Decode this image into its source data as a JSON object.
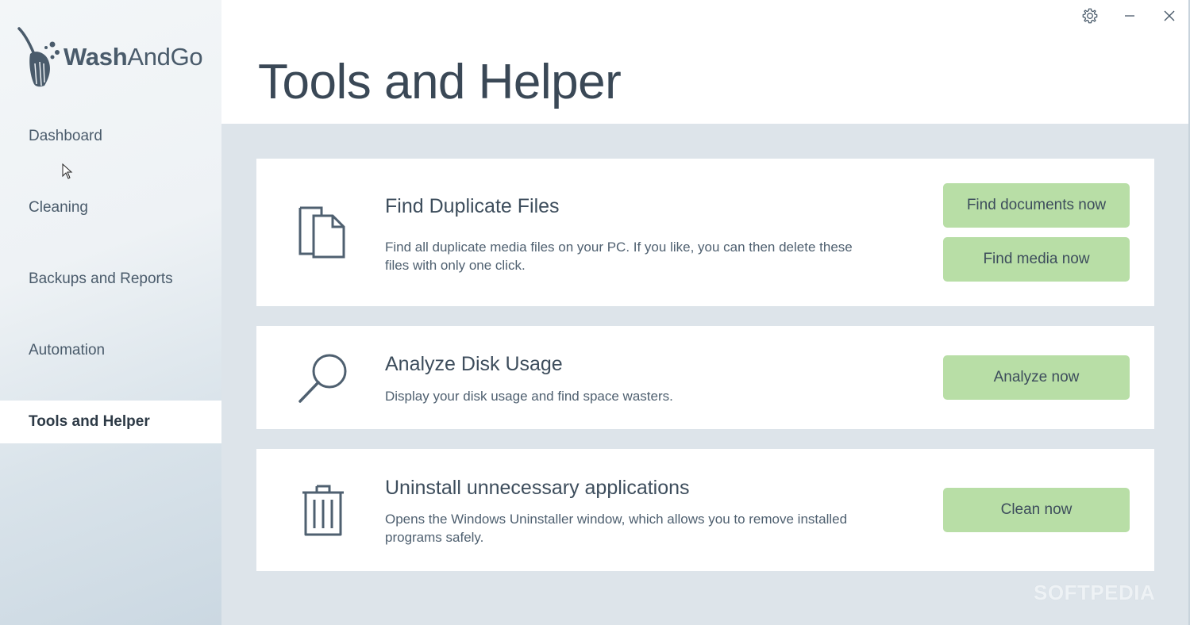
{
  "app": {
    "logo_text_bold": "Wash",
    "logo_text_light": "AndGo"
  },
  "sidebar": {
    "items": [
      {
        "label": "Dashboard",
        "active": false
      },
      {
        "label": "Cleaning",
        "active": false
      },
      {
        "label": "Backups and Reports",
        "active": false
      },
      {
        "label": "Automation",
        "active": false
      },
      {
        "label": "Tools and Helper",
        "active": true
      }
    ]
  },
  "window_controls": {
    "settings_icon": "gear-icon",
    "minimize_icon": "minimize-icon",
    "close_icon": "close-icon"
  },
  "page": {
    "title": "Tools and Helper"
  },
  "cards": [
    {
      "icon": "duplicate-files-icon",
      "title": "Find Duplicate Files",
      "description": "Find all duplicate media files on your PC. If you like, you can then delete these files with only one click.",
      "buttons": [
        "Find documents now",
        "Find media now"
      ]
    },
    {
      "icon": "magnifier-icon",
      "title": "Analyze Disk Usage",
      "description": "Display your disk usage and find space wasters.",
      "buttons": [
        "Analyze now"
      ]
    },
    {
      "icon": "trash-icon",
      "title": "Uninstall unnecessary applications",
      "description": "Opens the Windows Uninstaller window, which allows you to remove installed programs safely.",
      "buttons": [
        "Clean now"
      ]
    }
  ],
  "watermark": "SOFTPEDIA",
  "colors": {
    "button_bg": "#b8dea6",
    "content_bg": "#dde4ea",
    "text": "#3d4d5c"
  }
}
